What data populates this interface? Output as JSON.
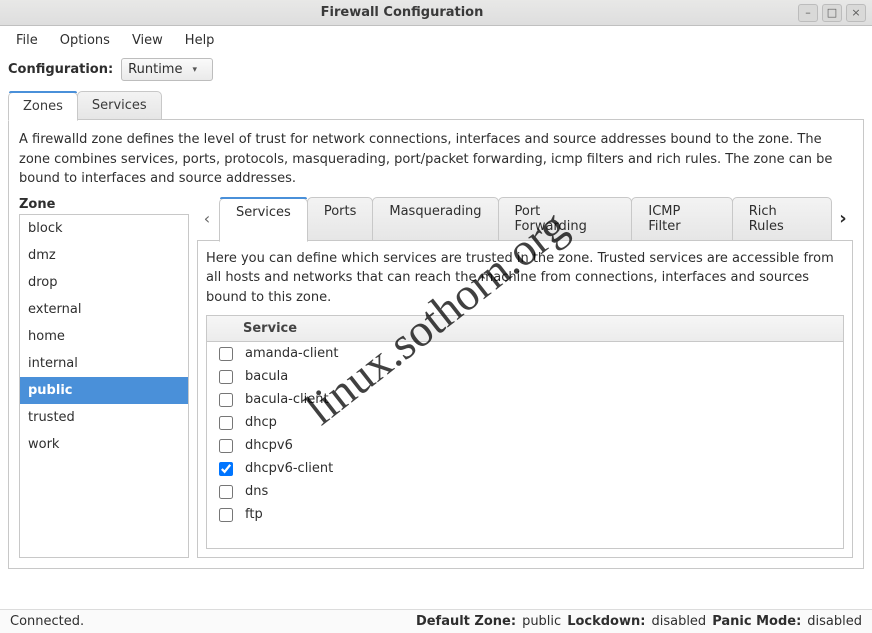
{
  "window": {
    "title": "Firewall Configuration"
  },
  "menu": {
    "file": "File",
    "options": "Options",
    "view": "View",
    "help": "Help"
  },
  "config": {
    "label": "Configuration:",
    "value": "Runtime"
  },
  "outer_tabs": {
    "zones": "Zones",
    "services": "Services",
    "active": "zones"
  },
  "zone_description": "A firewalld zone defines the level of trust for network connections, interfaces and source addresses bound to the zone. The zone combines services, ports, protocols, masquerading, port/packet forwarding, icmp filters and rich rules. The zone can be bound to interfaces and source addresses.",
  "zone_label": "Zone",
  "zones": [
    {
      "name": "block",
      "selected": false
    },
    {
      "name": "dmz",
      "selected": false
    },
    {
      "name": "drop",
      "selected": false
    },
    {
      "name": "external",
      "selected": false
    },
    {
      "name": "home",
      "selected": false
    },
    {
      "name": "internal",
      "selected": false
    },
    {
      "name": "public",
      "selected": true
    },
    {
      "name": "trusted",
      "selected": false
    },
    {
      "name": "work",
      "selected": false
    }
  ],
  "inner_tabs": {
    "services": "Services",
    "ports": "Ports",
    "masq": "Masquerading",
    "portfwd": "Port Forwarding",
    "icmp": "ICMP Filter",
    "rich": "Rich Rules",
    "active": "services"
  },
  "services_description": "Here you can define which services are trusted in the zone. Trusted services are accessible from all hosts and networks that can reach the machine from connections, interfaces and sources bound to this zone.",
  "service_header": "Service",
  "services": [
    {
      "name": "amanda-client",
      "checked": false
    },
    {
      "name": "bacula",
      "checked": false
    },
    {
      "name": "bacula-client",
      "checked": false
    },
    {
      "name": "dhcp",
      "checked": false
    },
    {
      "name": "dhcpv6",
      "checked": false
    },
    {
      "name": "dhcpv6-client",
      "checked": true
    },
    {
      "name": "dns",
      "checked": false
    },
    {
      "name": "ftp",
      "checked": false
    }
  ],
  "status": {
    "connection": "Connected.",
    "default_zone_label": "Default Zone:",
    "default_zone_value": "public",
    "lockdown_label": "Lockdown:",
    "lockdown_value": "disabled",
    "panic_label": "Panic Mode:",
    "panic_value": "disabled"
  },
  "watermark": "linux.sothorn.org"
}
